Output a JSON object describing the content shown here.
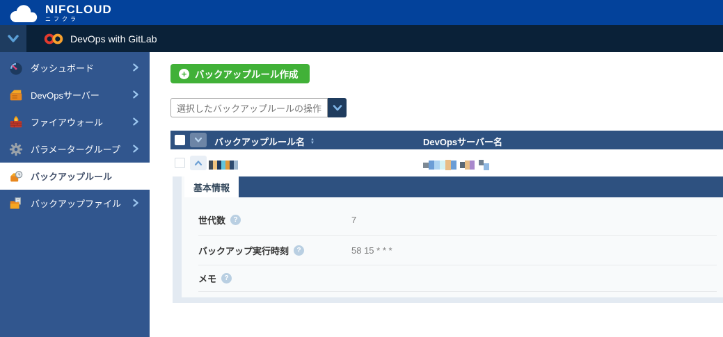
{
  "brand": {
    "name": "NIFCLOUD",
    "subtitle": "ニフクラ"
  },
  "service_bar": {
    "title": "DevOps with GitLab"
  },
  "sidebar": {
    "items": [
      {
        "label": "ダッシュボード",
        "icon": "dashboard-icon",
        "active": false
      },
      {
        "label": "DevOpsサーバー",
        "icon": "server-icon",
        "active": false
      },
      {
        "label": "ファイアウォール",
        "icon": "firewall-icon",
        "active": false
      },
      {
        "label": "パラメーターグループ",
        "icon": "gear-icon",
        "active": false
      },
      {
        "label": "バックアップルール",
        "icon": "backup-rule-icon",
        "active": true
      },
      {
        "label": "バックアップファイル",
        "icon": "backup-file-icon",
        "active": false
      }
    ]
  },
  "toolbar": {
    "create_button_label": "バックアップルール作成",
    "bulk_action_label": "選択したバックアップルールの操作"
  },
  "table": {
    "columns": {
      "name": "バックアップルール名",
      "server": "DevOpsサーバー名"
    },
    "rows": [
      {
        "name_redacted": true,
        "server_redacted": true,
        "expanded": true
      }
    ]
  },
  "detail": {
    "tab": "基本情報",
    "fields": [
      {
        "label": "世代数",
        "value": "7"
      },
      {
        "label": "バックアップ実行時刻",
        "value": "58 15 * * *"
      },
      {
        "label": "メモ",
        "value": ""
      }
    ]
  },
  "icons": {
    "help": "?",
    "plus": "+",
    "sort_asc": "▲",
    "sort_desc": "▼"
  },
  "colors": {
    "topbar": "#03429b",
    "navbar": "#0a2138",
    "navbar_box": "#1e3c60",
    "sidebar": "#31568e",
    "table_header": "#2e5180",
    "accent_green": "#41b138",
    "panel_bg": "#f8fafb",
    "panel_accent": "#e3eaf2"
  }
}
